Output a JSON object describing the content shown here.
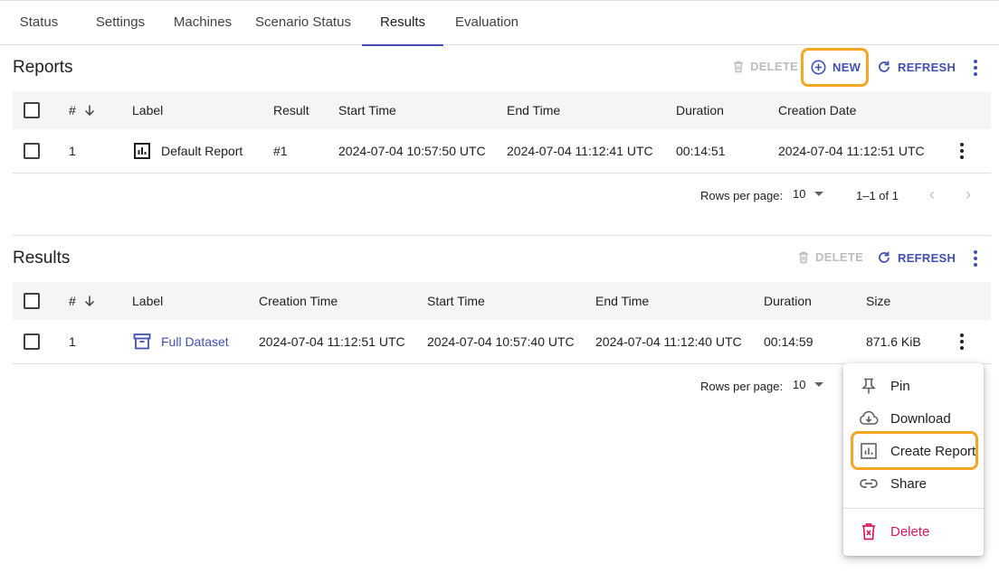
{
  "tabs": [
    {
      "label": "Status"
    },
    {
      "label": "Settings"
    },
    {
      "label": "Machines"
    },
    {
      "label": "Scenario Status"
    },
    {
      "label": "Results",
      "active": true
    },
    {
      "label": "Evaluation"
    }
  ],
  "colors": {
    "primary": "#3f51b5",
    "highlight": "#f5a623",
    "danger": "#d81b60",
    "disabled": "#bdbdbd"
  },
  "reports": {
    "title": "Reports",
    "actions": {
      "delete": "DELETE",
      "new": "NEW",
      "refresh": "REFRESH"
    },
    "columns": [
      "#",
      "Label",
      "Result",
      "Start Time",
      "End Time",
      "Duration",
      "Creation Date"
    ],
    "rows": [
      {
        "num": "1",
        "icon": "report-chart-icon",
        "label": "Default Report",
        "result": "#1",
        "start": "2024-07-04  10:57:50 UTC",
        "end": "2024-07-04  11:12:41 UTC",
        "duration": "00:14:51",
        "created": "2024-07-04  11:12:51 UTC"
      }
    ],
    "pagination": {
      "rows_label": "Rows per page:",
      "rows_value": "10",
      "range": "1–1 of 1"
    }
  },
  "results": {
    "title": "Results",
    "actions": {
      "delete": "DELETE",
      "refresh": "REFRESH"
    },
    "columns": [
      "#",
      "Label",
      "Creation Time",
      "Start Time",
      "End Time",
      "Duration",
      "Size"
    ],
    "rows": [
      {
        "num": "1",
        "icon": "archive-icon",
        "label": "Full Dataset",
        "created": "2024-07-04  11:12:51 UTC",
        "start": "2024-07-04  10:57:40 UTC",
        "end": "2024-07-04  11:12:40 UTC",
        "duration": "00:14:59",
        "size": "871.6 KiB"
      }
    ],
    "pagination": {
      "rows_label": "Rows per page:",
      "rows_value": "10"
    }
  },
  "context_menu": {
    "items": [
      {
        "label": "Pin",
        "icon": "pin-icon"
      },
      {
        "label": "Download",
        "icon": "cloud-download-icon"
      },
      {
        "label": "Create Report",
        "icon": "report-chart-icon",
        "highlighted": true
      },
      {
        "label": "Share",
        "icon": "link-icon"
      },
      {
        "label": "Delete",
        "icon": "trash-icon",
        "danger": true
      }
    ]
  }
}
